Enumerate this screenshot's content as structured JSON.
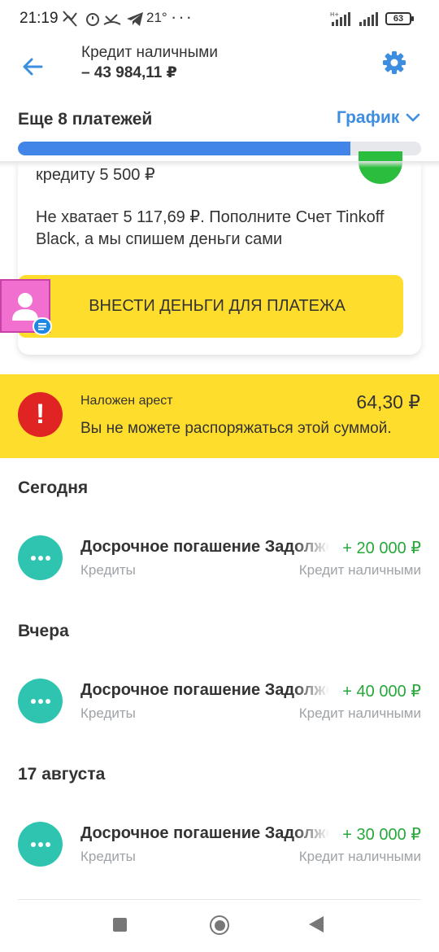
{
  "status_bar": {
    "time": "21:19",
    "temperature": "21°",
    "more": "···",
    "battery": "63",
    "network": "H+"
  },
  "header": {
    "title": "Кредит наличными",
    "balance": "– 43 984,11 ₽",
    "back_icon": "arrow-left-icon",
    "settings_icon": "gear-icon",
    "accent_color": "#3e8ee0"
  },
  "payments": {
    "remaining_label": "Еще 8 платежей",
    "schedule_label": "График",
    "progress_fraction": 0.825
  },
  "notice_card": {
    "text_top": "кредиту 5 500 ₽",
    "text_main": "Не хватает 5 117,69 ₽. Пополните Счет Tinkoff Black, а мы спишем деньги сами",
    "button_label": "ВНЕСТИ ДЕНЬГИ ДЛЯ ПЛАТЕЖА",
    "button_color": "#ffdd2d"
  },
  "arrest": {
    "title": "Наложен арест",
    "amount": "64,30 ₽",
    "text": "Вы не можете распоряжаться этой суммой."
  },
  "operations": [
    {
      "date": "Сегодня",
      "title": "Досрочное погашение Задолженности",
      "amount": "+ 20 000 ₽",
      "category": "Кредиты",
      "product": "Кредит наличными"
    },
    {
      "date": "Вчера",
      "title": "Досрочное погашение Задолженности",
      "amount": "+ 40 000 ₽",
      "category": "Кредиты",
      "product": "Кредит наличными"
    },
    {
      "date": "17 августа",
      "title": "Досрочное погашение Задолженности",
      "amount": "+ 30 000 ₽",
      "category": "Кредиты",
      "product": "Кредит наличными"
    }
  ],
  "colors": {
    "income": "#27a83a",
    "op_icon": "#2ec4b0",
    "alert": "#e02424",
    "progress": "#4185e8"
  }
}
